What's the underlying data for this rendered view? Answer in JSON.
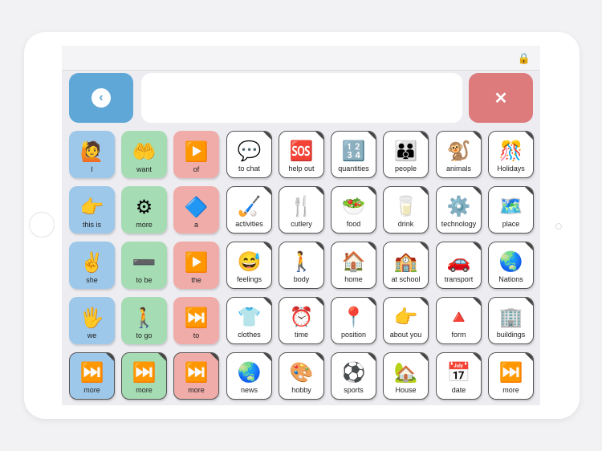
{
  "colors": {
    "blue": "#9ec8ea",
    "green": "#a5dcb3",
    "red": "#f0aca9",
    "white": "#ffffff",
    "back": "#5ea7d6",
    "delete": "#dd7a7c"
  },
  "topbar": {
    "lock_icon": "lock-icon"
  },
  "controls": {
    "back_icon": "‹",
    "delete_icon": "✕"
  },
  "grid": [
    [
      {
        "label": "I",
        "icon": "🙋",
        "color": "blue"
      },
      {
        "label": "want",
        "icon": "🤲",
        "color": "green"
      },
      {
        "label": "of",
        "icon": "▶️",
        "color": "red"
      },
      {
        "label": "to chat",
        "icon": "💬",
        "color": "white",
        "folder": true
      },
      {
        "label": "help out",
        "icon": "🆘",
        "color": "white",
        "folder": true
      },
      {
        "label": "quantities",
        "icon": "🔢",
        "color": "white",
        "folder": true
      },
      {
        "label": "people",
        "icon": "👪",
        "color": "white",
        "folder": true
      },
      {
        "label": "animals",
        "icon": "🐒",
        "color": "white",
        "folder": true
      },
      {
        "label": "Holidays",
        "icon": "🎊",
        "color": "white",
        "folder": true
      }
    ],
    [
      {
        "label": "this is",
        "icon": "👉",
        "color": "blue"
      },
      {
        "label": "more",
        "icon": "⚙",
        "color": "green"
      },
      {
        "label": "a",
        "icon": "🔷",
        "color": "red"
      },
      {
        "label": "activities",
        "icon": "🏑",
        "color": "white",
        "folder": true
      },
      {
        "label": "cutlery",
        "icon": "🍴",
        "color": "white",
        "folder": true
      },
      {
        "label": "food",
        "icon": "🥗",
        "color": "white",
        "folder": true
      },
      {
        "label": "drink",
        "icon": "🥛",
        "color": "white",
        "folder": true
      },
      {
        "label": "technology",
        "icon": "⚙️",
        "color": "white",
        "folder": true
      },
      {
        "label": "place",
        "icon": "🗺️",
        "color": "white",
        "folder": true
      }
    ],
    [
      {
        "label": "she",
        "icon": "✌️",
        "color": "blue"
      },
      {
        "label": "to be",
        "icon": "➖",
        "color": "green"
      },
      {
        "label": "the",
        "icon": "▶️",
        "color": "red"
      },
      {
        "label": "feelings",
        "icon": "😅",
        "color": "white",
        "folder": true
      },
      {
        "label": "body",
        "icon": "🚶",
        "color": "white",
        "folder": true
      },
      {
        "label": "home",
        "icon": "🏠",
        "color": "white",
        "folder": true
      },
      {
        "label": "at school",
        "icon": "🏫",
        "color": "white",
        "folder": true
      },
      {
        "label": "transport",
        "icon": "🚗",
        "color": "white",
        "folder": true
      },
      {
        "label": "Nations",
        "icon": "🌏",
        "color": "white",
        "folder": true
      }
    ],
    [
      {
        "label": "we",
        "icon": "🖐️",
        "color": "blue"
      },
      {
        "label": "to go",
        "icon": "🚶",
        "color": "green"
      },
      {
        "label": "to",
        "icon": "⏭️",
        "color": "red"
      },
      {
        "label": "clothes",
        "icon": "👕",
        "color": "white",
        "folder": true
      },
      {
        "label": "time",
        "icon": "⏰",
        "color": "white",
        "folder": true
      },
      {
        "label": "position",
        "icon": "📍",
        "color": "white",
        "folder": true
      },
      {
        "label": "about you",
        "icon": "👉",
        "color": "white",
        "folder": true
      },
      {
        "label": "form",
        "icon": "🔺",
        "color": "white",
        "folder": true
      },
      {
        "label": "buildings",
        "icon": "🏢",
        "color": "white",
        "folder": true
      }
    ],
    [
      {
        "label": "more",
        "icon": "⏭️",
        "color": "blue",
        "folder": true
      },
      {
        "label": "more",
        "icon": "⏭️",
        "color": "green",
        "folder": true
      },
      {
        "label": "more",
        "icon": "⏭️",
        "color": "red",
        "folder": true
      },
      {
        "label": "news",
        "icon": "🌏",
        "color": "white",
        "folder": true
      },
      {
        "label": "hobby",
        "icon": "🎨",
        "color": "white",
        "folder": true
      },
      {
        "label": "sports",
        "icon": "⚽",
        "color": "white",
        "folder": true
      },
      {
        "label": "House",
        "icon": "🏡",
        "color": "white",
        "folder": true
      },
      {
        "label": "date",
        "icon": "📅",
        "color": "white",
        "folder": true
      },
      {
        "label": "more",
        "icon": "⏭️",
        "color": "white",
        "folder": true
      }
    ]
  ]
}
